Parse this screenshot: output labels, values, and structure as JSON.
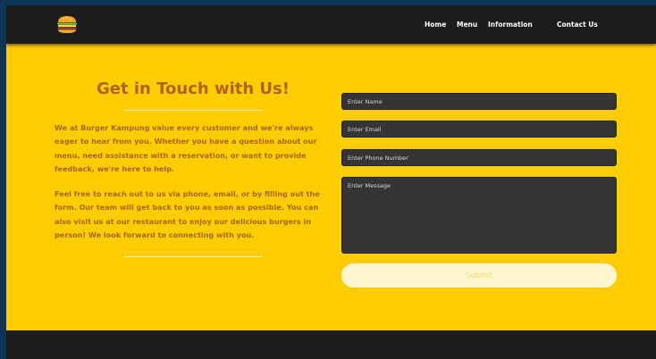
{
  "nav": {
    "logo_icon": "burger-icon",
    "links": [
      "Home",
      "Menu",
      "Information",
      "Contact Us"
    ]
  },
  "contact": {
    "title": "Get in Touch with Us!",
    "paragraphs": [
      "We at Burger Kampung value every customer and we're always eager to hear from you. Whether you have a question about our menu, need assistance with a reservation, or want to provide feedback, we're here to help.",
      "Feel free to reach out to us via phone, email, or by filling out the form. Our team will get back to you as soon as possible. You can also visit us at our restaurant to enjoy our delicious burgers in person! We look forward to connecting with you."
    ]
  },
  "form": {
    "name_placeholder": "Enter Name",
    "email_placeholder": "Enter Email",
    "phone_placeholder": "Enter Phone Number",
    "message_placeholder": "Enter Message",
    "submit_label": "Submit"
  },
  "colors": {
    "accent": "#ffcc00",
    "heading": "#b0621f",
    "navbar": "#1c1c1c",
    "field": "#353535",
    "submit_bg": "#fdf5cf"
  }
}
